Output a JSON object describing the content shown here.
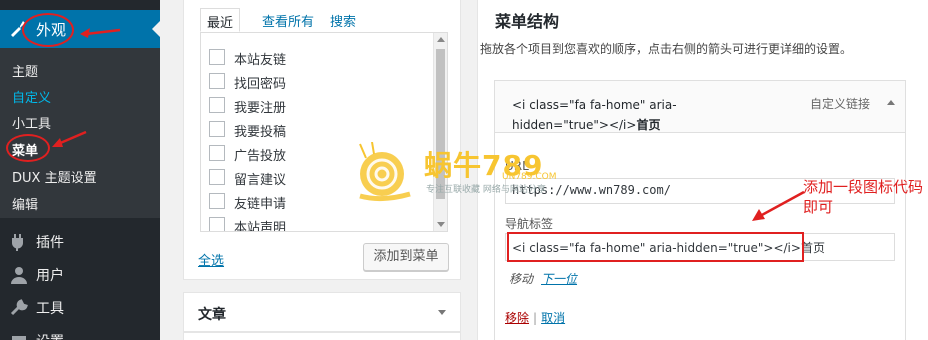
{
  "sidebar": {
    "active_label": "外观",
    "submenu": [
      "主题",
      "自定义",
      "小工具",
      "菜单",
      "DUX 主题设置",
      "编辑"
    ],
    "items": [
      "插件",
      "用户",
      "工具",
      "设置"
    ]
  },
  "pages_box": {
    "tabs": [
      "最近",
      "查看所有",
      "搜索"
    ],
    "pages": [
      "本站友链",
      "找回密码",
      "我要注册",
      "我要投稿",
      "广告投放",
      "留言建议",
      "友链申请",
      "本站声明"
    ],
    "select_all": "全选",
    "add_button": "添加到菜单"
  },
  "posts_box": {
    "title": "文章"
  },
  "structure": {
    "title": "菜单结构",
    "description": "拖放各个项目到您喜欢的顺序，点击右侧的箭头可进行更详细的设置。",
    "item": {
      "title_code": "<i class=\"fa fa-home\" aria-hidden=\"true\"></i>",
      "title_text": "首页",
      "type": "自定义链接",
      "url_label": "URL",
      "url_value": "https://www.wn789.com/",
      "nav_label": "导航标签",
      "nav_value": "<i class=\"fa fa-home\" aria-hidden=\"true\"></i>首页",
      "move_label": "移动",
      "move_link": "下一位",
      "remove": "移除",
      "sep": "|",
      "cancel": "取消"
    }
  },
  "annotation": "添加一段图标代码即可",
  "watermark": {
    "brand": "蜗牛789",
    "sub": "UN789.COM",
    "tag": "专注互联收藏  网络与网站分享"
  },
  "colors": {
    "accent": "#0073aa",
    "annotation": "#e02020",
    "sidebar": "#23282d"
  }
}
